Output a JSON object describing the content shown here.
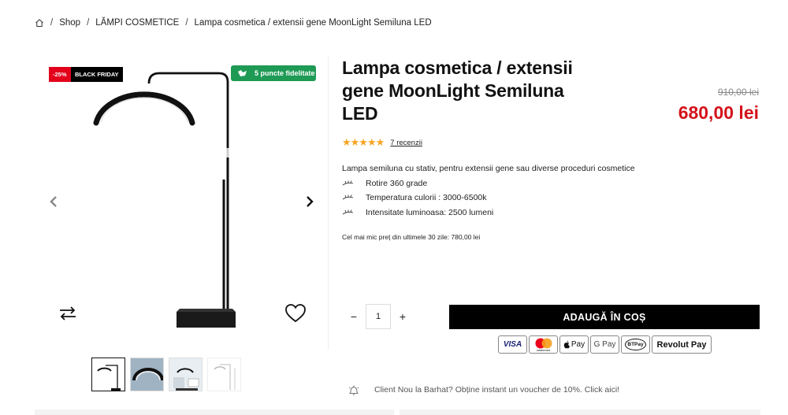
{
  "breadcrumb": {
    "home_icon": "home-icon",
    "sep": "/",
    "items": [
      "Shop",
      "LĂMPI COSMETICE",
      "Lampa cosmetica / extensii gene MoonLight Semiluna LED"
    ]
  },
  "badges": {
    "discount": "-25%",
    "black_friday": "BLACK FRIDAY",
    "points": "5 puncte fidelitate",
    "points_icon": "loyalty-points-icon"
  },
  "product": {
    "title": "Lampa cosmetica / extensii gene MoonLight Semiluna LED",
    "old_price": "910,00 lei",
    "new_price": "680,00 lei",
    "rating": 5,
    "stars": "★★★★★",
    "reviews": "7 recenzii",
    "description": "Lampa semiluna cu stativ, pentru extensii gene sau diverse proceduri cosmetice",
    "features": [
      "Rotire 360 grade",
      "Temperatura culorii : 3000-6500k",
      "Intensitate luminoasa: 2500 lumeni"
    ],
    "lowest_price": "Cel mai mic preț din ultimele 30 zile: 780,00 lei"
  },
  "cart": {
    "minus": "−",
    "plus": "+",
    "quantity": "1",
    "add_to_cart": "ADAUGĂ ÎN COȘ"
  },
  "payments": [
    "VISA",
    "mastercard",
    "Pay",
    "G Pay",
    "BTPay",
    "Revolut Pay"
  ],
  "voucher": "Client Nou la Barhat? Obține instant un voucher de 10%. Click aici!",
  "colors": {
    "price_red": "#d4121b",
    "badge_red": "#e3001b",
    "points_green": "#1e9a55",
    "star_gold": "#f5a623"
  }
}
